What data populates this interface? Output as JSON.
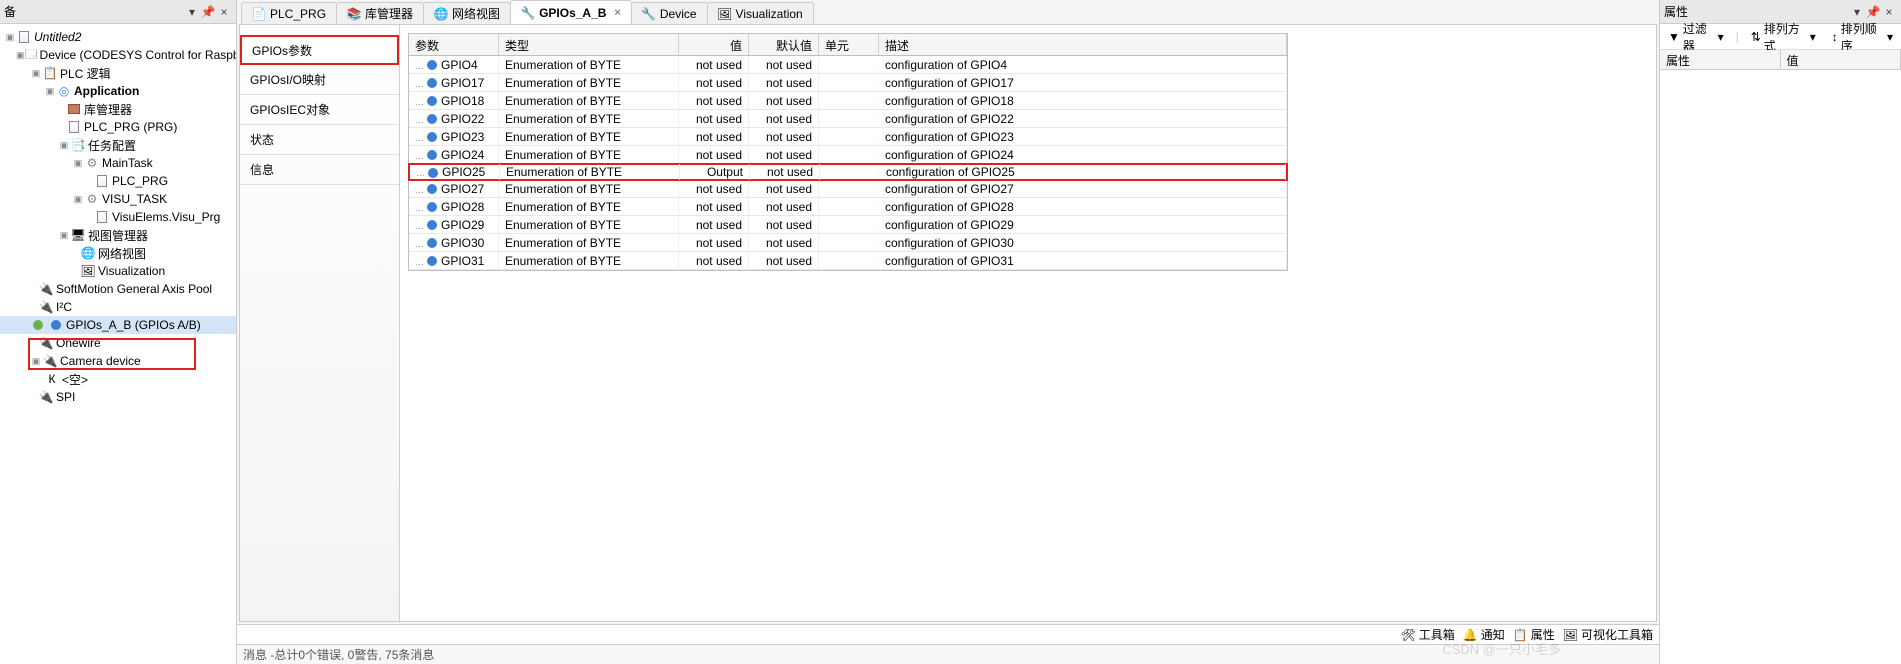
{
  "leftPanel": {
    "title": "备",
    "pin": "📌",
    "close": "×"
  },
  "tree": {
    "root": "Untitled2",
    "device": "Device (CODESYS Control for Raspberry Pi SL)",
    "plcLogic": "PLC 逻辑",
    "application": "Application",
    "libMgr": "库管理器",
    "plcPrg": "PLC_PRG (PRG)",
    "taskCfg": "任务配置",
    "mainTask": "MainTask",
    "plcPrgTask": "PLC_PRG",
    "visuTask": "VISU_TASK",
    "visuElems": "VisuElems.Visu_Prg",
    "visuMgr": "视图管理器",
    "netView": "网络视图",
    "visualization": "Visualization",
    "softMotion": "SoftMotion General Axis Pool",
    "i2c": "I²C",
    "gpios": "GPIOs_A_B (GPIOs A/B)",
    "onewire": "Onewire",
    "camera": "Camera device",
    "empty": "<空>",
    "spi": "SPI"
  },
  "tabs": [
    {
      "label": "PLC_PRG",
      "icon": "doc"
    },
    {
      "label": "库管理器",
      "icon": "lib"
    },
    {
      "label": "网络视图",
      "icon": "net"
    },
    {
      "label": "GPIOs_A_B",
      "icon": "dev",
      "active": true,
      "close": true
    },
    {
      "label": "Device",
      "icon": "dev"
    },
    {
      "label": "Visualization",
      "icon": "visu"
    }
  ],
  "sideTabs": {
    "params": "GPIOs参数",
    "ioMap": "GPIOsI/O映射",
    "iecObj": "GPIOsIEC对象",
    "status": "状态",
    "info": "信息"
  },
  "gridHeaders": {
    "param": "参数",
    "type": "类型",
    "value": "值",
    "default": "默认值",
    "unit": "单元",
    "desc": "描述"
  },
  "gridRows": [
    {
      "p": "GPIO4",
      "t": "Enumeration of BYTE",
      "v": "not used",
      "d": "not used",
      "desc": "configuration of GPIO4"
    },
    {
      "p": "GPIO17",
      "t": "Enumeration of BYTE",
      "v": "not used",
      "d": "not used",
      "desc": "configuration of GPIO17"
    },
    {
      "p": "GPIO18",
      "t": "Enumeration of BYTE",
      "v": "not used",
      "d": "not used",
      "desc": "configuration of GPIO18"
    },
    {
      "p": "GPIO22",
      "t": "Enumeration of BYTE",
      "v": "not used",
      "d": "not used",
      "desc": "configuration of GPIO22"
    },
    {
      "p": "GPIO23",
      "t": "Enumeration of BYTE",
      "v": "not used",
      "d": "not used",
      "desc": "configuration of GPIO23"
    },
    {
      "p": "GPIO24",
      "t": "Enumeration of BYTE",
      "v": "not used",
      "d": "not used",
      "desc": "configuration of GPIO24"
    },
    {
      "p": "GPIO25",
      "t": "Enumeration of BYTE",
      "v": "Output",
      "d": "not used",
      "desc": "configuration of GPIO25",
      "hl": true
    },
    {
      "p": "GPIO27",
      "t": "Enumeration of BYTE",
      "v": "not used",
      "d": "not used",
      "desc": "configuration of GPIO27"
    },
    {
      "p": "GPIO28",
      "t": "Enumeration of BYTE",
      "v": "not used",
      "d": "not used",
      "desc": "configuration of GPIO28"
    },
    {
      "p": "GPIO29",
      "t": "Enumeration of BYTE",
      "v": "not used",
      "d": "not used",
      "desc": "configuration of GPIO29"
    },
    {
      "p": "GPIO30",
      "t": "Enumeration of BYTE",
      "v": "not used",
      "d": "not used",
      "desc": "configuration of GPIO30"
    },
    {
      "p": "GPIO31",
      "t": "Enumeration of BYTE",
      "v": "not used",
      "d": "not used",
      "desc": "configuration of GPIO31"
    }
  ],
  "statusItems": {
    "toolbox": "工具箱",
    "notify": "通知",
    "props": "属性",
    "visuToolbox": "可视化工具箱"
  },
  "rightPanel": {
    "title": "属性",
    "filter": "过滤器",
    "sortBy": "排列方式",
    "sortOrder": "排列顺序",
    "colProp": "属性",
    "colVal": "值"
  },
  "msgBar": "消息 -总计0个错误, 0警告, 75条消息",
  "watermark": "CSDN @一只小毛多"
}
